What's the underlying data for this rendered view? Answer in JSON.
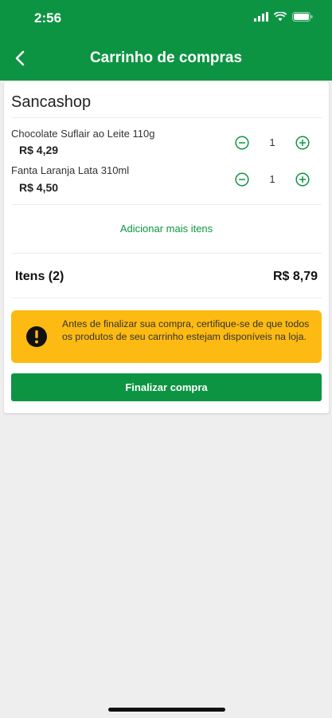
{
  "status_bar": {
    "time": "2:56"
  },
  "header": {
    "title": "Carrinho de compras"
  },
  "store": {
    "name": "Sancashop"
  },
  "items": [
    {
      "name": "Chocolate Suflair ao Leite 110g",
      "price": "R$ 4,29",
      "quantity": "1"
    },
    {
      "name": "Fanta Laranja Lata 310ml",
      "price": "R$ 4,50",
      "quantity": "1"
    }
  ],
  "add_more": "Adicionar mais itens",
  "summary": {
    "label": "Itens (2)",
    "total": "R$ 8,79"
  },
  "warning": {
    "text": "Antes de finalizar sua compra, certifique-se de que todos os produtos de seu carrinho estejam disponíveis na loja."
  },
  "finalize_button": "Finalizar compra",
  "colors": {
    "brand_green": "#0d9443",
    "warning_yellow": "#fdba12"
  }
}
